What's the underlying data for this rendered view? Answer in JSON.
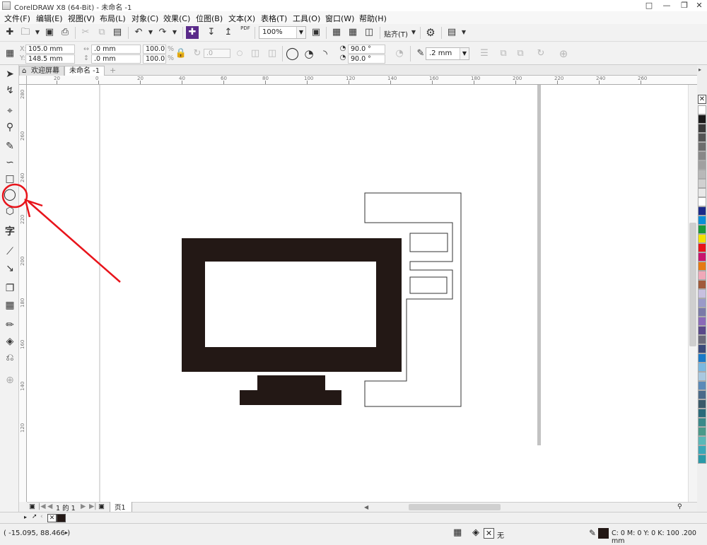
{
  "titlebar": {
    "title": "CorelDRAW X8 (64-Bit) - 未命名 -1"
  },
  "menu": [
    "文件(F)",
    "编辑(E)",
    "视图(V)",
    "布局(L)",
    "对象(C)",
    "效果(C)",
    "位图(B)",
    "文本(X)",
    "表格(T)",
    "工具(O)",
    "窗口(W)",
    "帮助(H)"
  ],
  "stdbar": {
    "zoom": "100%",
    "snap": "贴齐(T)",
    "pdf_label": "PDF"
  },
  "propbar": {
    "x": "105.0 mm",
    "y": "148.5 mm",
    "w": ".0 mm",
    "h": ".0 mm",
    "sx": "100.0",
    "sy": "100.0",
    "pct": "%",
    "rot": ".0",
    "angle1": "90.0 °",
    "angle2": "90.0 °",
    "outline": ".2 mm"
  },
  "tabs": {
    "welcome": "欢迎屏幕",
    "doc": "未命名 -1"
  },
  "ruler_h": [
    "20",
    "0",
    "20",
    "40",
    "60",
    "80",
    "100",
    "120",
    "140",
    "160",
    "180",
    "200",
    "220",
    "240",
    "260"
  ],
  "ruler_v": [
    "280",
    "260",
    "240",
    "220",
    "200",
    "180",
    "160",
    "140",
    "120"
  ],
  "ruler_unit": "毫米",
  "pagenav": {
    "page_of": "1 的 1",
    "page_tab": "页1"
  },
  "status": {
    "coords": "( -15.095, 88.466 )",
    "fill_none": "无",
    "outline_info": "C: 0 M: 0 Y: 0 K: 100  .200 mm"
  },
  "colors": {
    "annotation": "#e8141b",
    "monitor_fill": "#231815"
  },
  "palette": [
    "#ffffff",
    "#1a1a1a",
    "#3a3a3a",
    "#555555",
    "#6e6e6e",
    "#888888",
    "#a0a0a0",
    "#b8b8b8",
    "#d0d0d0",
    "#e8e8e8",
    "#ffffff",
    "#1b2a8a",
    "#0a8fd8",
    "#1a9a3a",
    "#f2e100",
    "#e8141b",
    "#c8146e",
    "#e57a14",
    "#f0a8b8",
    "#a05a3a",
    "#c8c0e0",
    "#9a9ac8",
    "#7a7aa8",
    "#8a6ab8",
    "#5a4a8a",
    "#6a6a7a",
    "#3a4a7a",
    "#1a7ac8",
    "#7ab8e0",
    "#a8c8e0",
    "#5a8ab8",
    "#4a6a8a",
    "#3a5a6a",
    "#2a6a7a",
    "#3a8a8a",
    "#4a9a8a",
    "#5ab8b8",
    "#3aa8b8",
    "#2a9aa8"
  ]
}
